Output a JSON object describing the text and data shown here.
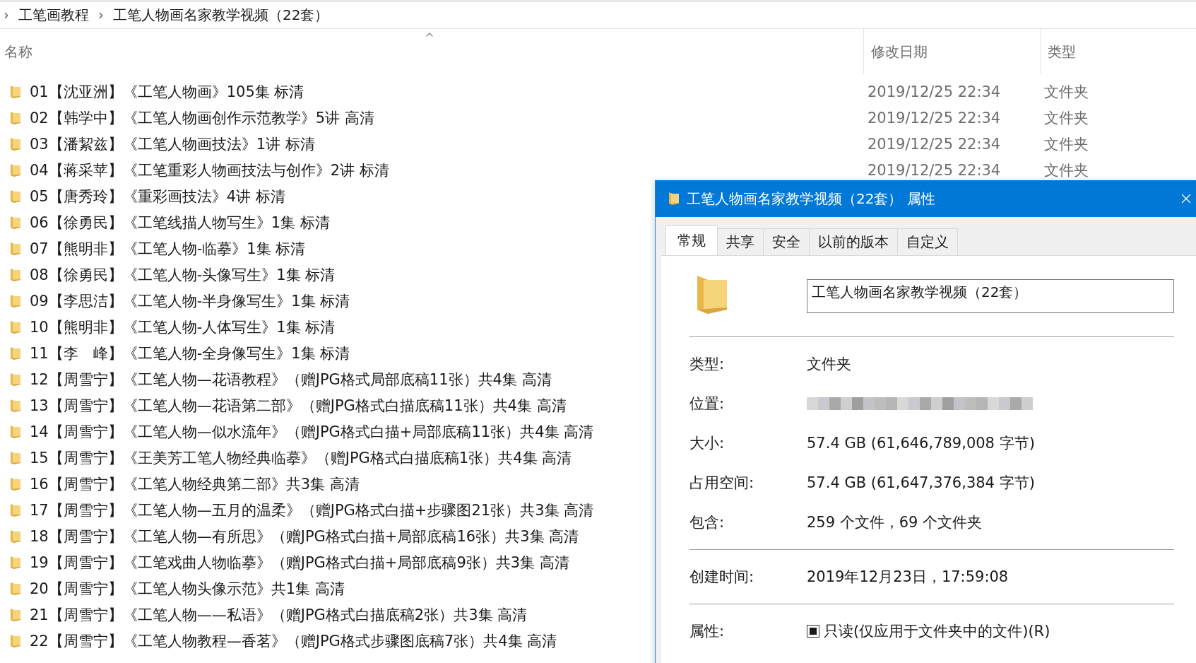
{
  "breadcrumb": [
    "工笔画教程",
    "工笔人物画名家教学视频（22套）"
  ],
  "columns": [
    {
      "label": "名称"
    },
    {
      "label": "修改日期"
    },
    {
      "label": "类型"
    }
  ],
  "files": [
    {
      "name": "01【沈亚洲】《工笔人物画》105集 标清",
      "date": "2019/12/25 22:34",
      "type": "文件夹"
    },
    {
      "name": "02【韩学中】《工笔人物画创作示范教学》5讲 高清",
      "date": "2019/12/25 22:34",
      "type": "文件夹"
    },
    {
      "name": "03【潘絜兹】《工笔人物画技法》1讲 标清",
      "date": "2019/12/25 22:34",
      "type": "文件夹"
    },
    {
      "name": "04【蒋采苹】《工笔重彩人物画技法与创作》2讲 标清",
      "date": "2019/12/25 22:34",
      "type": "文件夹"
    },
    {
      "name": "05【唐秀玲】《重彩画技法》4讲 标清"
    },
    {
      "name": "06【徐勇民】《工笔线描人物写生》1集 标清"
    },
    {
      "name": "07【熊明非】《工笔人物-临摹》1集 标清"
    },
    {
      "name": "08【徐勇民】《工笔人物-头像写生》1集 标清"
    },
    {
      "name": "09【李思洁】《工笔人物-半身像写生》1集 标清"
    },
    {
      "name": "10【熊明非】《工笔人物-人体写生》1集 标清"
    },
    {
      "name": "11【李　峰】《工笔人物-全身像写生》1集 标清"
    },
    {
      "name": "12【周雪宁】《工笔人物—花语教程》（赠JPG格式局部底稿11张）共4集 高清"
    },
    {
      "name": "13【周雪宁】《工笔人物—花语第二部》（赠JPG格式白描底稿11张）共4集 高清"
    },
    {
      "name": "14【周雪宁】《工笔人物—似水流年》（赠JPG格式白描+局部底稿11张）共4集 高清"
    },
    {
      "name": "15【周雪宁】《王美芳工笔人物经典临摹》（赠JPG格式白描底稿1张）共4集 高清"
    },
    {
      "name": "16【周雪宁】《工笔人物经典第二部》共3集 高清"
    },
    {
      "name": "17【周雪宁】《工笔人物—五月的温柔》（赠JPG格式白描+步骤图21张）共3集 高清"
    },
    {
      "name": "18【周雪宁】《工笔人物—有所思》（赠JPG格式白描+局部底稿16张）共3集 高清"
    },
    {
      "name": "19【周雪宁】《工笔戏曲人物临摹》（赠JPG格式白描+局部底稿9张）共3集 高清"
    },
    {
      "name": "20【周雪宁】《工笔人物头像示范》共1集 高清"
    },
    {
      "name": "21【周雪宁】《工笔人物——私语》（赠JPG格式白描底稿2张）共3集 高清"
    },
    {
      "name": "22【周雪宁】《工笔人物教程—香茗》（赠JPG格式步骤图底稿7张）共4集 高清"
    }
  ],
  "dialog": {
    "title": "工笔人物画名家教学视频（22套） 属性",
    "tabs": [
      {
        "label": "常规",
        "selected": true
      },
      {
        "label": "共享",
        "selected": false
      },
      {
        "label": "安全",
        "selected": false
      },
      {
        "label": "以前的版本",
        "selected": false
      },
      {
        "label": "自定义",
        "selected": false
      }
    ],
    "name_field": {
      "value": "工笔人物画名家教学视频（22套）"
    },
    "sections": [
      [
        {
          "label": "类型:",
          "value": "文件夹"
        },
        {
          "label": "位置:",
          "kind": "blurred"
        },
        {
          "label": "大小:",
          "value": "57.4 GB (61,646,789,008 字节)"
        },
        {
          "label": "占用空间:",
          "value": "57.4 GB (61,647,376,384 字节)"
        },
        {
          "label": "包含:",
          "value": "259 个文件，69 个文件夹"
        }
      ],
      [
        {
          "label": "创建时间:",
          "value": "2019年12月23日，17:59:08"
        }
      ],
      [
        {
          "label": "属性:",
          "kind": "checkbox",
          "value": "只读(仅应用于文件夹中的文件)(R)",
          "indeterminate": true
        }
      ]
    ]
  }
}
